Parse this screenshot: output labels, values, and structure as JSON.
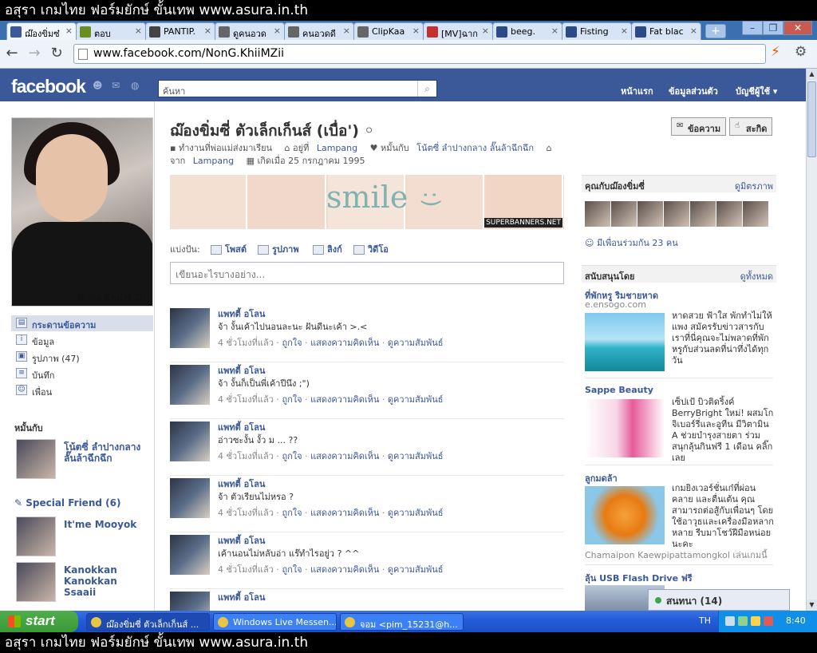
{
  "overlay": {
    "top": "อสุรา เกมไทย ฟอร์มยักษ์ ขั้นเทพ www.asura.in.th",
    "bottom": "อสุรา เกมไทย ฟอร์มยักษ์ ขั้นเทพ www.asura.in.th"
  },
  "browser": {
    "tabs": [
      {
        "label": "ฌ๊องขิ่มซ๋",
        "color": "#3b5998",
        "active": true
      },
      {
        "label": "ตอบ",
        "color": "#6b8e23"
      },
      {
        "label": "PANTIP.",
        "color": "#444"
      },
      {
        "label": "ดูคนอวด",
        "color": "#666"
      },
      {
        "label": "คนอวดดี",
        "color": "#666"
      },
      {
        "label": "ClipKaa",
        "color": "#666"
      },
      {
        "label": "[MV]ฉาก",
        "color": "#c4302b"
      },
      {
        "label": "beeg.",
        "color": "#2a4a8a"
      },
      {
        "label": "Fisting",
        "color": "#2a4a8a"
      },
      {
        "label": "Fat blac",
        "color": "#2a4a8a"
      }
    ],
    "new_tab": "+",
    "url": "www.facebook.com/NonG.KhiiMZii",
    "back": "←",
    "forward": "→",
    "reload": "↻",
    "win_min": "–",
    "win_max": "❐",
    "win_close": "✕"
  },
  "fb": {
    "logo": "facebook",
    "search_placeholder": "ค้นหา",
    "nav": {
      "home": "หน้าแรก",
      "profile": "ข้อมูลส่วนตัว",
      "account": "บัญชีผู้ใช้ ▾"
    },
    "profile_caption": "It'Me KhiiM'Zii",
    "left_nav": [
      {
        "label": "กระดานข้อความ",
        "icon": "▤",
        "selected": true
      },
      {
        "label": "ข้อมูล",
        "icon": "i"
      },
      {
        "label": "รูปภาพ (47)",
        "icon": "▣"
      },
      {
        "label": "บันทึก",
        "icon": "≡"
      },
      {
        "label": "เพื่อน",
        "icon": "☺"
      }
    ],
    "engaged_heading": "หมั้นกับ",
    "engaged_name": "โน้ตซี่ ลำปางกลาง ลั๊นล้าฉึกฉึก",
    "special_friend_heading": "Special Friend (6)",
    "special_friends": [
      {
        "name": "It'me Mooyok"
      },
      {
        "name": "Kanokkan Kanokkan Ssaaii"
      }
    ],
    "name": "ฌ๊องขิ่มซี่ ตัวเล็กเก็นส์ (เบื่อ') ◦",
    "btn_message": "ข้อความ",
    "btn_poke": "สะกิด",
    "info": {
      "work": "ทำงานที่พ่อแม่ส่งมาเรียน",
      "lives": "อยู่ที่",
      "lives_place": "Lampang",
      "engaged": "หมั้นกับ",
      "engaged_to": "โน้ตซี่ ลำปางกลาง ลั๊นล้าฉึกฉึก",
      "from": "จาก",
      "from_place": "Lampang",
      "born": "เกิดเมื่อ 25 กรกฎาคม 1995"
    },
    "banner": {
      "word": "smile",
      "face": ":)",
      "credit": "SUPERBANNERS.NET"
    },
    "share": {
      "label": "แบ่งปัน:",
      "post": "โพสต์",
      "photo": "รูปภาพ",
      "link": "ลิงก์",
      "video": "วิดีโอ"
    },
    "composer_placeholder": "เขียนอะไรบางอย่าง...",
    "stories": [
      {
        "author": "แพทตี้ อโลน",
        "text": "จ้า งั้นเค้าไปนอนละนะ ฝันดีนะเค้า >.<",
        "time": "4 ชั่วโมงที่แล้ว",
        "like": "ถูกใจ",
        "comment": "แสดงความคิดเห็น",
        "see": "ดูความสัมพันธ์"
      },
      {
        "author": "แพทตี้ อโลน",
        "text": "จ้า งั้นก็เป็นพี่เค้าปีนึง ;\")",
        "time": "4 ชั่วโมงที่แล้ว",
        "like": "ถูกใจ",
        "comment": "แสดงความคิดเห็น",
        "see": "ดูความสัมพันธ์"
      },
      {
        "author": "แพทตี้ อโลน",
        "text": "อ่าวซะงั้น งั้ว ม ... ??",
        "time": "4 ชั่วโมงที่แล้ว",
        "like": "ถูกใจ",
        "comment": "แสดงความคิดเห็น",
        "see": "ดูความสัมพันธ์"
      },
      {
        "author": "แพทตี้ อโลน",
        "text": "จ้า ตัวเรียนไม่หรอ ?",
        "time": "4 ชั่วโมงที่แล้ว",
        "like": "ถูกใจ",
        "comment": "แสดงความคิดเห็น",
        "see": "ดูความสัมพันธ์"
      },
      {
        "author": "แพทตี้ อโลน",
        "text": "เค้านอนไม่หลับอ่า แร๊ทำไรอยู่ว ? ^^",
        "time": "4 ชั่วโมงที่แล้ว",
        "like": "ถูกใจ",
        "comment": "แสดงความคิดเห็น",
        "see": "ดูความสัมพันธ์"
      },
      {
        "author": "แพทตี้ อโลน",
        "text": "",
        "time": "",
        "like": "",
        "comment": "",
        "see": ""
      }
    ],
    "right": {
      "mutual_heading": "คุณกับฌ๊องขิ่มซี่",
      "mutual_link": "ดูมิตรภาพ",
      "mutual_count": "มีเพื่อนร่วมกัน 23 คน",
      "sponsored_heading": "สนับสนุนโดย",
      "sponsored_link": "ดูทั้งหมด",
      "ads": [
        {
          "title": "ที่พักหรู ริมชายหาด",
          "sub": "e.ensogo.com",
          "text": "หาดสวย ฟ้าใส พักทำไม่ให้แพง สมัครรับข่าวสารกับเราที่นี่คุณจะไม่พลาดที่พักหรูกับส่วนลดที่น่าทึ่งได้ทุกวัน"
        },
        {
          "title": "Sappe Beauty",
          "sub": "",
          "text": "เซ็ปเป้ บิวติดริ้งค์ BerryBright ใหม่! ผสมโกจิเบอร์รี่และอูทีน มีวิตามิน A ช่วยบำรุงสายตา ร่วมสนุกลุ้นกินฟรี 1 เดือน คลิ๊กเลย"
        },
        {
          "title": "ลูกมดล้า",
          "sub": "Chamaipon Kaewpipattamongkol เล่นเกมนี้",
          "text": "เกมยิงเวอร์ชั่นเก๋ที่ผ่อนคลาย และตื่นเต้น คุณสามารถต่อสู้กับเพื่อนๆ โดยใช้อาวุธและเครื่องมือหลากหลาย รีบมาโชว์ฝีมือหน่อยนะคะ"
        },
        {
          "title": "ลุ้น USB Flash Drive ฟรี",
          "sub": "",
          "text": ""
        }
      ]
    },
    "chat": "สนทนา (14)"
  },
  "taskbar": {
    "start": "start",
    "tasks": [
      "ฌ๊องขิ่มซี่ ตัวเล็กเก็นส์ ...",
      "Windows Live Messen...",
      "จอม <pim_15231@h..."
    ],
    "lang": "TH",
    "clock": "8:40"
  }
}
